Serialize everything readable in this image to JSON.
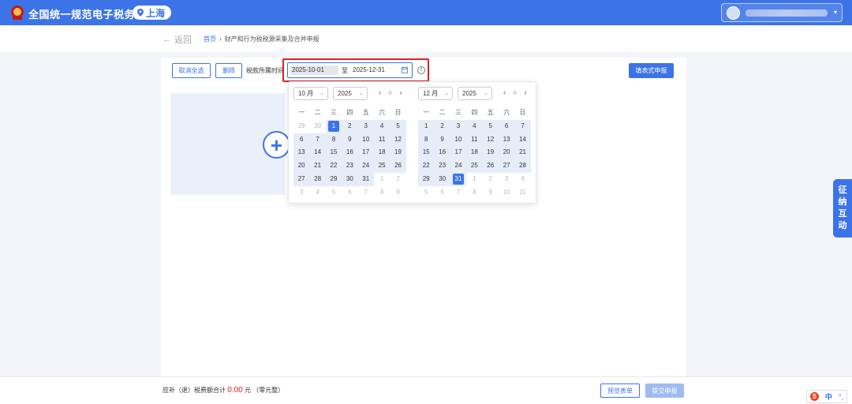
{
  "header": {
    "site_title": "全国统一规范电子税务局",
    "region": "上海",
    "user_caret": "▾"
  },
  "breadcrumb": {
    "back_arrow": "←",
    "back_label": "返回",
    "home": "首页",
    "separator": "›",
    "current": "财产和行为税税源采集及合并申报"
  },
  "toolbar": {
    "deselect_all": "取消全选",
    "delete": "删除",
    "period_label": "税款所属时间",
    "range_start": "2025-10-01",
    "range_sep": "至",
    "range_end": "2025-12-31",
    "form_declare": "填表式申报"
  },
  "upload": {
    "plus": "+"
  },
  "calendar": {
    "weekdays": [
      "一",
      "二",
      "三",
      "四",
      "五",
      "六",
      "日"
    ],
    "nav": [
      "‹",
      "○",
      "›"
    ],
    "left": {
      "month": "10 月",
      "year": "2025",
      "days": [
        {
          "d": "29",
          "o": true
        },
        {
          "d": "30",
          "o": true
        },
        {
          "d": "1",
          "s": true
        },
        {
          "d": "2"
        },
        {
          "d": "3"
        },
        {
          "d": "4"
        },
        {
          "d": "5"
        },
        {
          "d": "6"
        },
        {
          "d": "7"
        },
        {
          "d": "8"
        },
        {
          "d": "9"
        },
        {
          "d": "10"
        },
        {
          "d": "11"
        },
        {
          "d": "12"
        },
        {
          "d": "13"
        },
        {
          "d": "14"
        },
        {
          "d": "15"
        },
        {
          "d": "16"
        },
        {
          "d": "17"
        },
        {
          "d": "18"
        },
        {
          "d": "19"
        },
        {
          "d": "20"
        },
        {
          "d": "21"
        },
        {
          "d": "22"
        },
        {
          "d": "23"
        },
        {
          "d": "24"
        },
        {
          "d": "25"
        },
        {
          "d": "26"
        },
        {
          "d": "27"
        },
        {
          "d": "28"
        },
        {
          "d": "29"
        },
        {
          "d": "30"
        },
        {
          "d": "31"
        },
        {
          "d": "1",
          "o": true
        },
        {
          "d": "2",
          "o": true
        },
        {
          "d": "3",
          "o": true
        },
        {
          "d": "4",
          "o": true
        },
        {
          "d": "5",
          "o": true
        },
        {
          "d": "6",
          "o": true
        },
        {
          "d": "7",
          "o": true
        },
        {
          "d": "8",
          "o": true
        },
        {
          "d": "9",
          "o": true
        }
      ]
    },
    "right": {
      "month": "12 月",
      "year": "2025",
      "days": [
        {
          "d": "1"
        },
        {
          "d": "2"
        },
        {
          "d": "3"
        },
        {
          "d": "4"
        },
        {
          "d": "5"
        },
        {
          "d": "6"
        },
        {
          "d": "7"
        },
        {
          "d": "8"
        },
        {
          "d": "9"
        },
        {
          "d": "10"
        },
        {
          "d": "11"
        },
        {
          "d": "12"
        },
        {
          "d": "13"
        },
        {
          "d": "14"
        },
        {
          "d": "15"
        },
        {
          "d": "16"
        },
        {
          "d": "17"
        },
        {
          "d": "18"
        },
        {
          "d": "19"
        },
        {
          "d": "20"
        },
        {
          "d": "21"
        },
        {
          "d": "22"
        },
        {
          "d": "23"
        },
        {
          "d": "24"
        },
        {
          "d": "25"
        },
        {
          "d": "26"
        },
        {
          "d": "27"
        },
        {
          "d": "28"
        },
        {
          "d": "29"
        },
        {
          "d": "30"
        },
        {
          "d": "31",
          "s": true
        },
        {
          "d": "1",
          "o": true
        },
        {
          "d": "2",
          "o": true
        },
        {
          "d": "3",
          "o": true
        },
        {
          "d": "4",
          "o": true
        },
        {
          "d": "5",
          "o": true
        },
        {
          "d": "6",
          "o": true
        },
        {
          "d": "7",
          "o": true
        },
        {
          "d": "8",
          "o": true
        },
        {
          "d": "9",
          "o": true
        },
        {
          "d": "10",
          "o": true
        },
        {
          "d": "11",
          "o": true
        }
      ]
    }
  },
  "side_tab": [
    "征",
    "纳",
    "互",
    "动"
  ],
  "footer": {
    "total_label": "应补（退）税费额合计",
    "total_amount": "0.00",
    "total_unit": "元 （零元整）",
    "preview": "预览表单",
    "submit": "提交申报"
  },
  "ime": {
    "logo": "S",
    "lang": "中",
    "punct": "°,"
  },
  "colors": {
    "primary": "#3c74e8",
    "highlight": "#e02020",
    "range_bg": "#e6edf9"
  }
}
